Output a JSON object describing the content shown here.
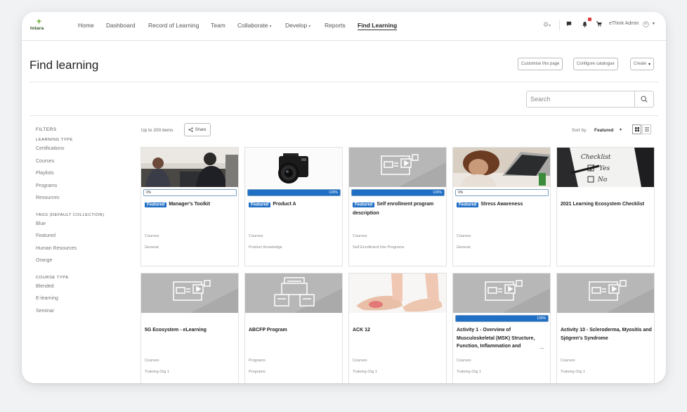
{
  "nav": {
    "logo_text": "totara",
    "items": [
      "Home",
      "Dashboard",
      "Record of Learning",
      "Team",
      "Collaborate",
      "Develop",
      "Reports",
      "Find Learning"
    ],
    "active": "Find Learning",
    "user": "eThink Admin"
  },
  "page": {
    "title": "Find learning",
    "buttons": {
      "customise": "Customise this page",
      "configure": "Configure catalogue",
      "create": "Create"
    }
  },
  "search": {
    "placeholder": "Search"
  },
  "filters": {
    "heading": "FILTERS",
    "sections": [
      {
        "label": "LEARNING TYPE",
        "items": [
          "Certifications",
          "Courses",
          "Playlists",
          "Programs",
          "Resources"
        ]
      },
      {
        "label": "TAGS (DEFAULT COLLECTION)",
        "items": [
          "Blue",
          "Featured",
          "Human Resources",
          "Orange"
        ]
      },
      {
        "label": "COURSE TYPE",
        "items": [
          "Blended",
          "E-learning",
          "Seminar"
        ]
      }
    ]
  },
  "toolbar": {
    "count": "Up to 200 items",
    "share": "Share",
    "sort_label": "Sort by",
    "sort_value": "Featured"
  },
  "cards": [
    {
      "title": "Manager's Toolkit",
      "featured": true,
      "progress": 0,
      "progress_label": "0%",
      "type": "Courses",
      "category": "General",
      "thumb": "photo-meeting"
    },
    {
      "title": "Product A",
      "featured": true,
      "progress": 100,
      "progress_label": "100%",
      "type": "Courses",
      "category": "Product Knowledge",
      "thumb": "photo-camera"
    },
    {
      "title": "Self enrollment program description",
      "featured": true,
      "progress": 100,
      "progress_label": "100%",
      "type": "Courses",
      "category": "Self Enrollment Into Programs",
      "thumb": "course-icon"
    },
    {
      "title": "Stress Awareness",
      "featured": true,
      "progress": 0,
      "progress_label": "0%",
      "type": "Courses",
      "category": "General",
      "thumb": "photo-stress"
    },
    {
      "title": "2021 Learning Ecosystem Checklist",
      "featured": false,
      "progress": null,
      "type": "",
      "category": "",
      "thumb": "photo-checklist"
    },
    {
      "title": "5G Ecosystem - eLearning",
      "featured": false,
      "progress": null,
      "type": "Courses",
      "category": "Training Org 1",
      "thumb": "course-icon"
    },
    {
      "title": "ABCFP Program",
      "featured": false,
      "progress": null,
      "type": "Programs",
      "category": "Programs",
      "thumb": "program-icon"
    },
    {
      "title": "ACK 12",
      "featured": false,
      "progress": null,
      "type": "Courses",
      "category": "Training Org 1",
      "thumb": "photo-feet"
    },
    {
      "title": "Activity 1 - Overview of Musculoskeletal (MSK) Structure, Function, Inflammation and",
      "featured": false,
      "progress": 100,
      "progress_label": "100%",
      "type": "Courses",
      "category": "Training Org 1",
      "thumb": "course-icon",
      "more": "..."
    },
    {
      "title": "Activity 10 - Scleroderma, Myositis and Sjögren's Syndrome",
      "featured": false,
      "progress": null,
      "type": "Courses",
      "category": "Training Org 1",
      "thumb": "course-icon"
    }
  ],
  "colors": {
    "accent": "#1f6fc5",
    "thumb_grey": "#b7b7b7"
  }
}
